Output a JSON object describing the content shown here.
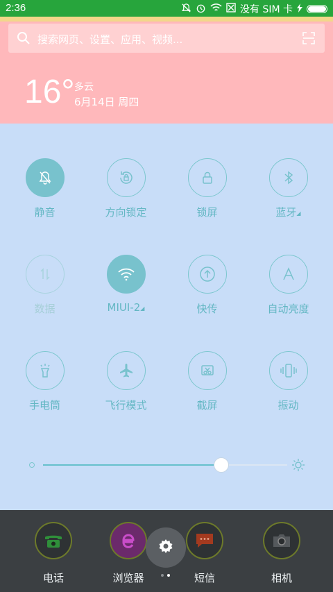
{
  "status_bar": {
    "time": "2:36",
    "sim_text": "没有 SIM 卡",
    "icons": [
      "alarm-off-icon",
      "alarm-icon",
      "wifi-icon",
      "sim-icon",
      "charging-icon",
      "battery-icon"
    ]
  },
  "search": {
    "placeholder": "搜索网页、设置、应用、视频..."
  },
  "weather": {
    "temperature": "16°",
    "condition": "多云",
    "date": "6月14日 周四"
  },
  "toggles": [
    {
      "label": "静音",
      "icon": "mute-bell-icon",
      "state": "on"
    },
    {
      "label": "方向锁定",
      "icon": "rotation-lock-icon",
      "state": "off"
    },
    {
      "label": "锁屏",
      "icon": "lock-icon",
      "state": "off"
    },
    {
      "label": "蓝牙",
      "icon": "bluetooth-icon",
      "state": "off",
      "has_menu": true
    },
    {
      "label": "数据",
      "icon": "data-arrows-icon",
      "state": "disabled"
    },
    {
      "label": "MIUI-2",
      "icon": "wifi-icon",
      "state": "on",
      "has_menu": true
    },
    {
      "label": "快传",
      "icon": "upload-icon",
      "state": "off"
    },
    {
      "label": "自动亮度",
      "icon": "auto-brightness-icon",
      "state": "off"
    },
    {
      "label": "手电筒",
      "icon": "flashlight-icon",
      "state": "off"
    },
    {
      "label": "飞行模式",
      "icon": "airplane-icon",
      "state": "off"
    },
    {
      "label": "截屏",
      "icon": "screenshot-icon",
      "state": "off"
    },
    {
      "label": "振动",
      "icon": "vibrate-icon",
      "state": "off"
    }
  ],
  "brightness": {
    "level": 0.73
  },
  "dock": {
    "apps": [
      {
        "label": "电话",
        "icon": "phone-icon"
      },
      {
        "label": "浏览器",
        "icon": "browser-icon"
      },
      {
        "label": "短信",
        "icon": "message-icon"
      },
      {
        "label": "相机",
        "icon": "camera-icon"
      }
    ],
    "page_count": 2,
    "active_page": 1
  },
  "colors": {
    "status_bar": "#27a53c",
    "header": "#ffb8bb",
    "panel": "#c8ddf8",
    "accent": "#78c2cd"
  }
}
